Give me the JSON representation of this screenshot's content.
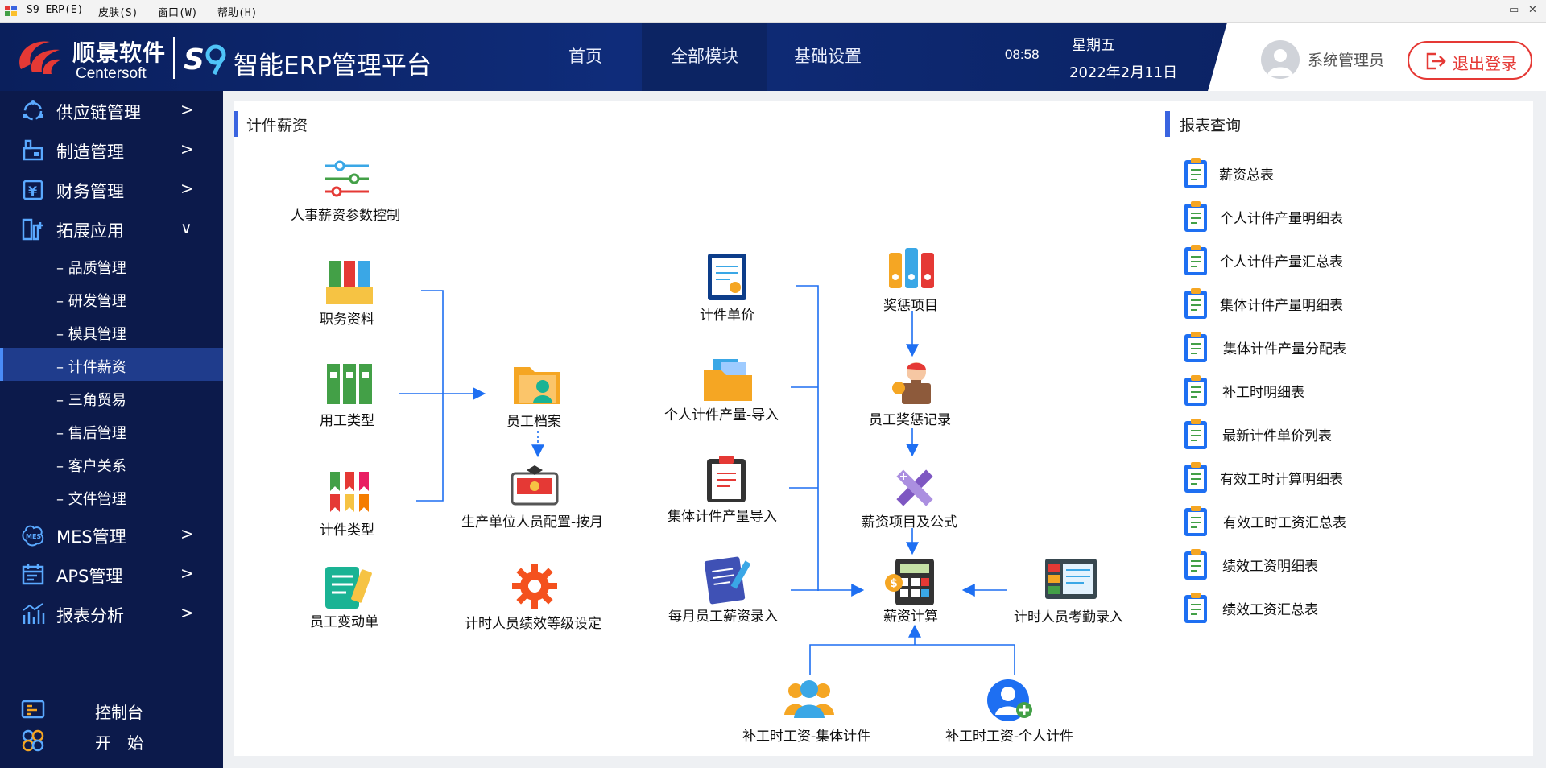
{
  "window": {
    "title": "S9 ERP(E)",
    "menus": [
      "S9 ERP(E)",
      "皮肤(S)",
      "窗口(W)",
      "帮助(H)"
    ],
    "controls": [
      "–",
      "▭",
      "✕"
    ]
  },
  "header": {
    "brand_cn": "顺景软件",
    "brand_en": "Centersoft",
    "platform": "智能ERP管理平台",
    "nav": [
      "首页",
      "全部模块",
      "基础设置"
    ],
    "active_nav": "全部模块",
    "time": "08:58",
    "weekday": "星期五",
    "date": "2022年2月11日",
    "user": "系统管理员",
    "logout": "退出登录",
    "colors": {
      "header_bg": "#0f2c7a",
      "accent": "#3a64e0",
      "logout": "#e53935"
    }
  },
  "sidebar": {
    "items": [
      {
        "label": "供应链管理",
        "icon": "supply-chain-icon",
        "arrow": ">"
      },
      {
        "label": "制造管理",
        "icon": "factory-icon",
        "arrow": ">"
      },
      {
        "label": "财务管理",
        "icon": "finance-icon",
        "arrow": ">"
      },
      {
        "label": "拓展应用",
        "icon": "extend-icon",
        "arrow": "∨"
      }
    ],
    "sub_items": [
      "品质管理",
      "研发管理",
      "模具管理",
      "计件薪资",
      "三角贸易",
      "售后管理",
      "客户关系",
      "文件管理"
    ],
    "active_sub": "计件薪资",
    "items2": [
      {
        "label": "MES管理",
        "icon": "mes-icon",
        "arrow": ">"
      },
      {
        "label": "APS管理",
        "icon": "aps-icon",
        "arrow": ">"
      },
      {
        "label": "报表分析",
        "icon": "report-analysis-icon",
        "arrow": ">"
      }
    ],
    "footer": [
      {
        "label": "控制台",
        "icon": "console-icon"
      },
      {
        "label": "开　始",
        "icon": "start-icon"
      }
    ]
  },
  "main": {
    "section_title": "计件薪资",
    "nodes": {
      "hr_param": "人事薪资参数控制",
      "job_info": "职务资料",
      "work_type": "用工类型",
      "piece_type": "计件类型",
      "emp_change": "员工变动单",
      "emp_file": "员工档案",
      "prod_config": "生产单位人员配置-按月",
      "perf_grade": "计时人员绩效等级设定",
      "piece_price": "计件单价",
      "personal_import": "个人计件产量-导入",
      "group_import": "集体计件产量导入",
      "monthly_salary": "每月员工薪资录入",
      "reward_item": "奖惩项目",
      "reward_record": "员工奖惩记录",
      "salary_formula": "薪资项目及公式",
      "salary_calc": "薪资计算",
      "attendance": "计时人员考勤录入",
      "makeup_group": "补工时工资-集体计件",
      "makeup_personal": "补工时工资-个人计件"
    }
  },
  "reports": {
    "section_title": "报表查询",
    "items": [
      "薪资总表",
      "个人计件产量明细表",
      "个人计件产量汇总表",
      "集体计件产量明细表",
      "集体计件产量分配表",
      "补工时明细表",
      "最新计件单价列表",
      "有效工时计算明细表",
      "有效工时工资汇总表",
      "绩效工资明细表",
      "绩效工资汇总表"
    ]
  }
}
